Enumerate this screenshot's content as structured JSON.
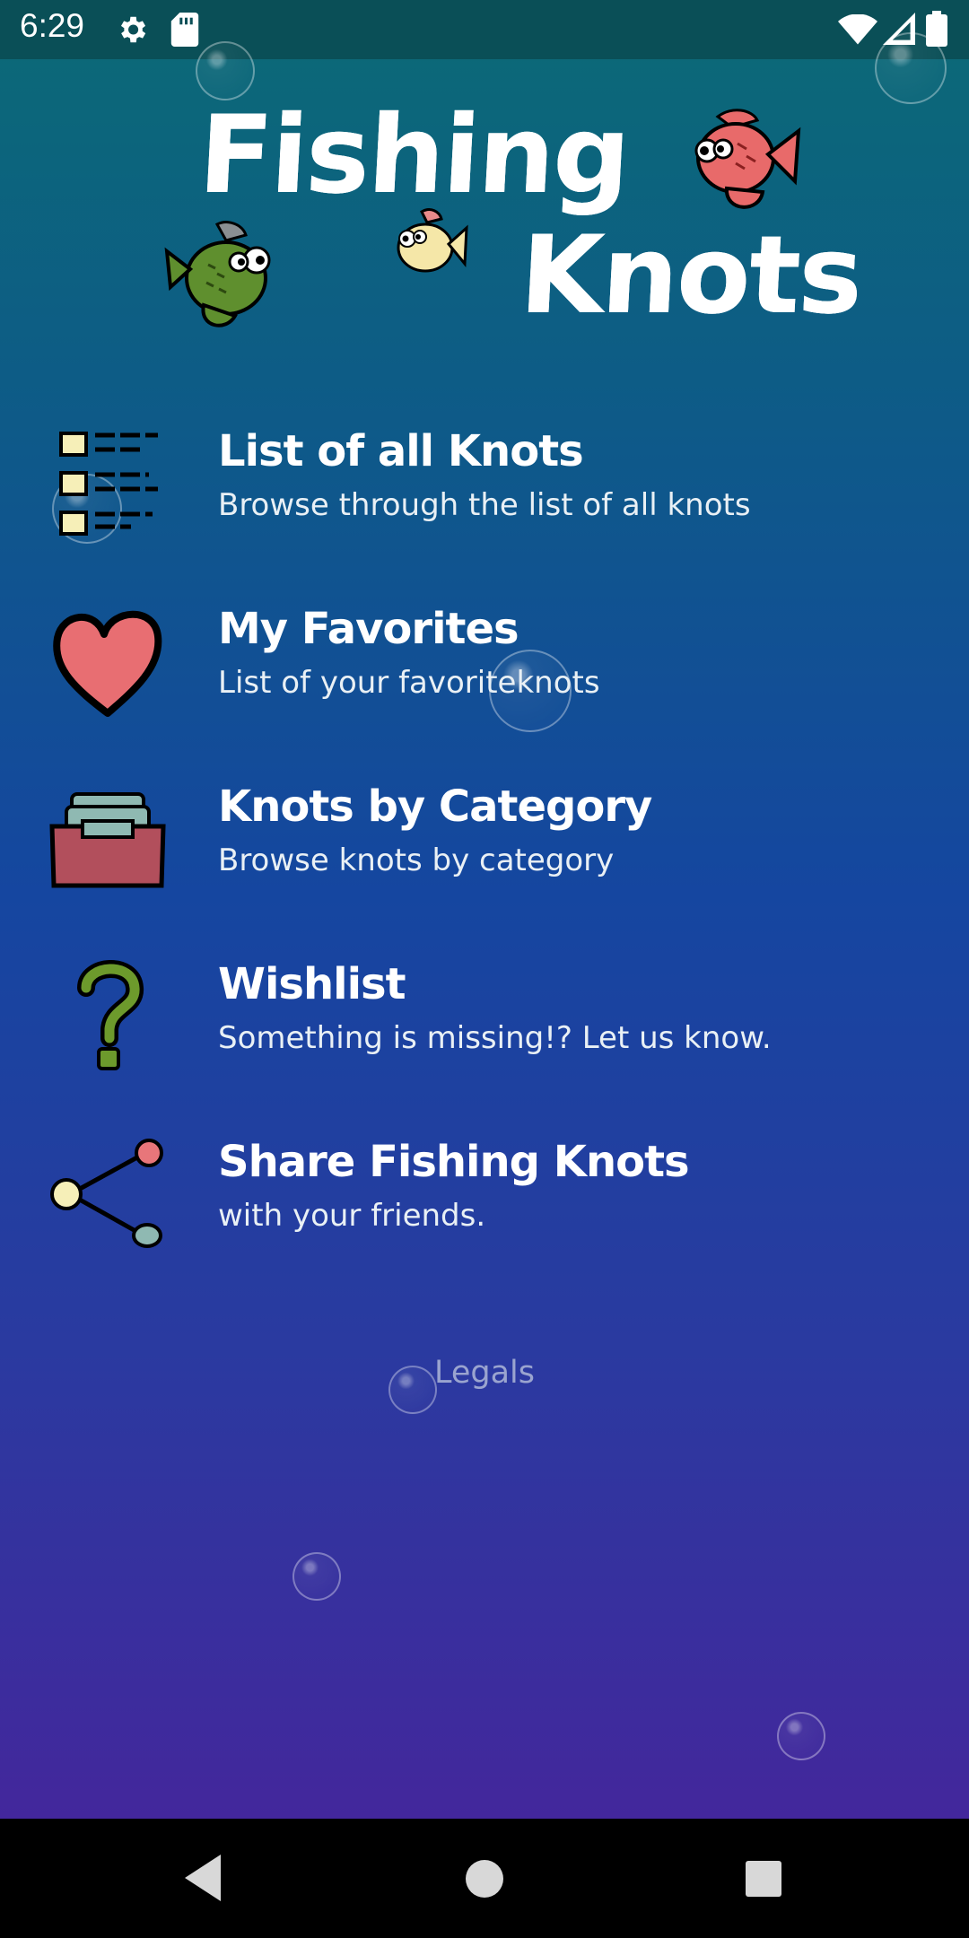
{
  "status_bar": {
    "time": "6:29",
    "icons": [
      "settings-icon",
      "sd-card-icon",
      "wifi-icon",
      "signal-icon",
      "battery-icon"
    ]
  },
  "logo": {
    "line1": "Fishing",
    "line2": "Knots"
  },
  "menu": [
    {
      "title": "List of all Knots",
      "subtitle": "Browse through the list of all knots",
      "icon": "checklist-icon"
    },
    {
      "title": "My Favorites",
      "subtitle": "List of your favoriteknots",
      "icon": "heart-icon"
    },
    {
      "title": "Knots by Category",
      "subtitle": "Browse knots by category",
      "icon": "file-box-icon"
    },
    {
      "title": "Wishlist",
      "subtitle": "Something is missing!? Let us know.",
      "icon": "question-mark-icon"
    },
    {
      "title": "Share Fishing Knots",
      "subtitle": "with your friends.",
      "icon": "share-icon"
    }
  ],
  "legals": "Legals",
  "nav_bar": {
    "icons": [
      "back-icon",
      "home-icon",
      "recents-icon"
    ]
  },
  "colors": {
    "gradient_top": "#0c6a76",
    "gradient_bottom": "#43279c",
    "status_bar": "#0a4f57",
    "legals_text": "#9aa4cf"
  }
}
